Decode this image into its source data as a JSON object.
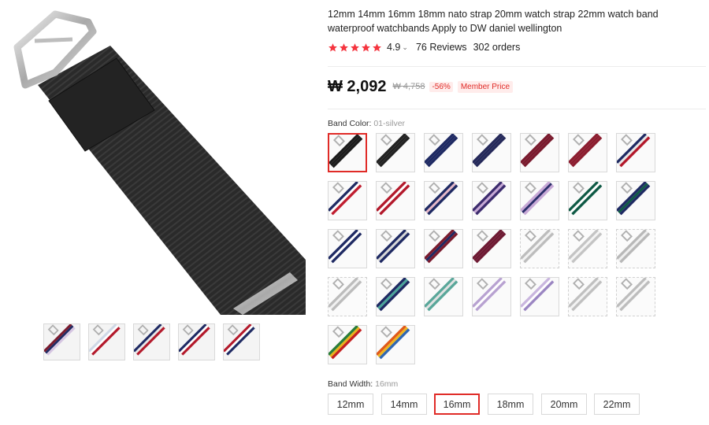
{
  "product": {
    "title": "12mm 14mm 16mm 18mm nato strap 20mm watch strap 22mm watch band waterproof watchbands Apply to DW daniel wellington",
    "rating": "4.9",
    "rating_stars": 5,
    "reviews": "76 Reviews",
    "orders": "302 orders"
  },
  "price": {
    "current": "₩ 2,092",
    "original": "₩ 4,758",
    "discount": "-56%",
    "member_label": "Member Price"
  },
  "band_color": {
    "label": "Band Color:",
    "selected": "01-silver",
    "swatches": [
      {
        "name": "01-silver",
        "colors": [
          "#1c1c1c",
          "#1c1c1c",
          "#1c1c1c"
        ],
        "selected": true
      },
      {
        "name": "black",
        "colors": [
          "#222222",
          "#222222",
          "#222222"
        ]
      },
      {
        "name": "navy",
        "colors": [
          "#1f2a63",
          "#1f2a63",
          "#1f2a63"
        ]
      },
      {
        "name": "dark-blue",
        "colors": [
          "#25295a",
          "#25295a",
          "#25295a"
        ]
      },
      {
        "name": "burgundy",
        "colors": [
          "#7a1b2e",
          "#7a1b2e",
          "#7a1b2e"
        ]
      },
      {
        "name": "wine",
        "colors": [
          "#8c1d2f",
          "#8c1d2f",
          "#8c1d2f"
        ]
      },
      {
        "name": "navy-red-white",
        "colors": [
          "#1f2a63",
          "#e8e8e8",
          "#b3192b"
        ]
      },
      {
        "name": "navy-white-red",
        "colors": [
          "#1f2a63",
          "#ffffff",
          "#c01e30"
        ]
      },
      {
        "name": "red-white-stripe",
        "colors": [
          "#b3192b",
          "#ffffff",
          "#b3192b"
        ]
      },
      {
        "name": "navy-pink-stripe",
        "colors": [
          "#1f2a63",
          "#e6b8c8",
          "#1f2a63"
        ]
      },
      {
        "name": "purple-lilac",
        "colors": [
          "#3d2c6e",
          "#c7a8d6",
          "#3d2c6e"
        ]
      },
      {
        "name": "lilac-navy",
        "colors": [
          "#c7a8d6",
          "#2b2d6a",
          "#c7a8d6"
        ]
      },
      {
        "name": "green-white",
        "colors": [
          "#0f5a45",
          "#ffffff",
          "#0f5a45"
        ]
      },
      {
        "name": "green-navy",
        "colors": [
          "#1f2a63",
          "#0f5a45",
          "#1f2a63"
        ]
      },
      {
        "name": "navy-white-stripe",
        "colors": [
          "#1f2a63",
          "#ffffff",
          "#1f2a63"
        ]
      },
      {
        "name": "navy-grey-stripe",
        "colors": [
          "#1f2a63",
          "#d8d8d8",
          "#1f2a63"
        ]
      },
      {
        "name": "maroon-navy",
        "colors": [
          "#7a1b2e",
          "#1f2a63",
          "#7a1b2e"
        ]
      },
      {
        "name": "maroon-purple",
        "colors": [
          "#6e1a33",
          "#6e1a33",
          "#6e1a33"
        ]
      },
      {
        "name": "grey-white-1",
        "colors": [
          "#bdbdbd",
          "#f2f2f2",
          "#bdbdbd"
        ],
        "dashed": true
      },
      {
        "name": "grey-white-2",
        "colors": [
          "#c4c4c4",
          "#f4f4f4",
          "#c4c4c4"
        ],
        "dashed": true
      },
      {
        "name": "grey-white-3",
        "colors": [
          "#b8b8b8",
          "#efefef",
          "#b8b8b8"
        ],
        "dashed": true
      },
      {
        "name": "grey-white-4",
        "colors": [
          "#bcbcbc",
          "#f1f1f1",
          "#bcbcbc"
        ],
        "dashed": true
      },
      {
        "name": "teal-navy",
        "colors": [
          "#1f2a63",
          "#4aa59a",
          "#1f2a63"
        ]
      },
      {
        "name": "teal-grey",
        "colors": [
          "#5aa79a",
          "#e2e2e2",
          "#5aa79a"
        ]
      },
      {
        "name": "lilac-white",
        "colors": [
          "#b8a2d1",
          "#ffffff",
          "#b8a2d1"
        ]
      },
      {
        "name": "lilac-pale",
        "colors": [
          "#c9b6de",
          "#ffffff",
          "#9b86c2"
        ]
      },
      {
        "name": "grey-white-5",
        "colors": [
          "#c0c0c0",
          "#f3f3f3",
          "#c0c0c0"
        ],
        "dashed": true
      },
      {
        "name": "grey-white-6",
        "colors": [
          "#bdbdbd",
          "#f5f5f5",
          "#bdbdbd"
        ],
        "dashed": true
      },
      {
        "name": "rainbow-red",
        "colors": [
          "#2a7d3a",
          "#e8b218",
          "#c42020"
        ]
      },
      {
        "name": "rainbow-orange",
        "colors": [
          "#e05a1a",
          "#f0b51d",
          "#3167b0"
        ]
      }
    ]
  },
  "band_width": {
    "label": "Band Width:",
    "selected": "16mm",
    "options": [
      "12mm",
      "14mm",
      "16mm",
      "18mm",
      "20mm",
      "22mm"
    ]
  },
  "gallery": {
    "thumbnails": [
      {
        "name": "multi-strap-thumb",
        "colors": [
          "#7a1b2e",
          "#1f2a63",
          "#d6c6e2"
        ]
      },
      {
        "name": "strap-detail-thumb",
        "colors": [
          "#cfd8e6",
          "#ffffff",
          "#b3192b"
        ]
      },
      {
        "name": "strap-set-thumb",
        "colors": [
          "#1f2a63",
          "#e8e8e8",
          "#b3192b"
        ]
      },
      {
        "name": "navy-red-thumb",
        "colors": [
          "#1f2a63",
          "#ffffff",
          "#b3192b"
        ]
      },
      {
        "name": "red-watch-thumb",
        "colors": [
          "#b3192b",
          "#ffffff",
          "#1f2a63"
        ]
      }
    ]
  },
  "colors": {
    "accent": "#e02b27",
    "star": "#f5353f"
  }
}
